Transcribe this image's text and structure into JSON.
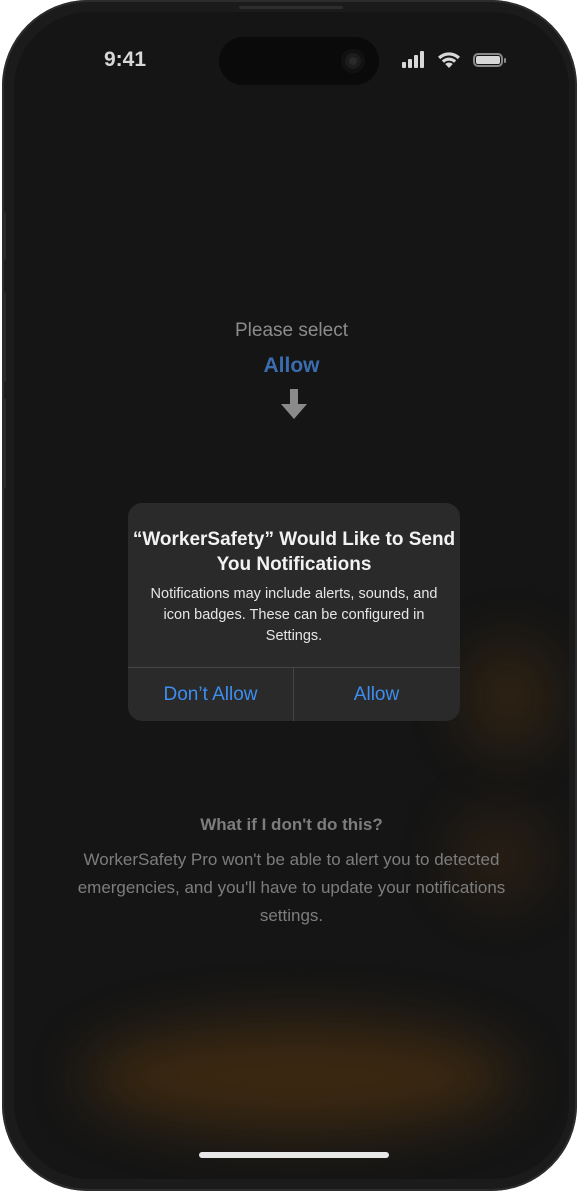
{
  "status_bar": {
    "time": "9:41",
    "icons": [
      "cellular-signal-icon",
      "wifi-icon",
      "battery-icon"
    ]
  },
  "prompt": {
    "title": "Please select",
    "highlight": "Allow",
    "arrow_icon": "arrow-down-icon",
    "highlight_color": "#3a6cb0"
  },
  "alert": {
    "title": "“WorkerSafety” Would Like to Send You Notifications",
    "message": "Notifications may include alerts, sounds, and icon badges. These can be configured in Settings.",
    "dont_allow_label": "Don’t Allow",
    "allow_label": "Allow",
    "button_color": "#3d8ef0"
  },
  "info": {
    "heading": "What if I don't do this?",
    "body": "WorkerSafety Pro won't be able to alert you to detected emergencies, and you'll have to update your notifications settings."
  },
  "colors": {
    "screen_background": "#151515",
    "alert_background": "#2a2a2a",
    "accent_glow": "#8c500a"
  }
}
